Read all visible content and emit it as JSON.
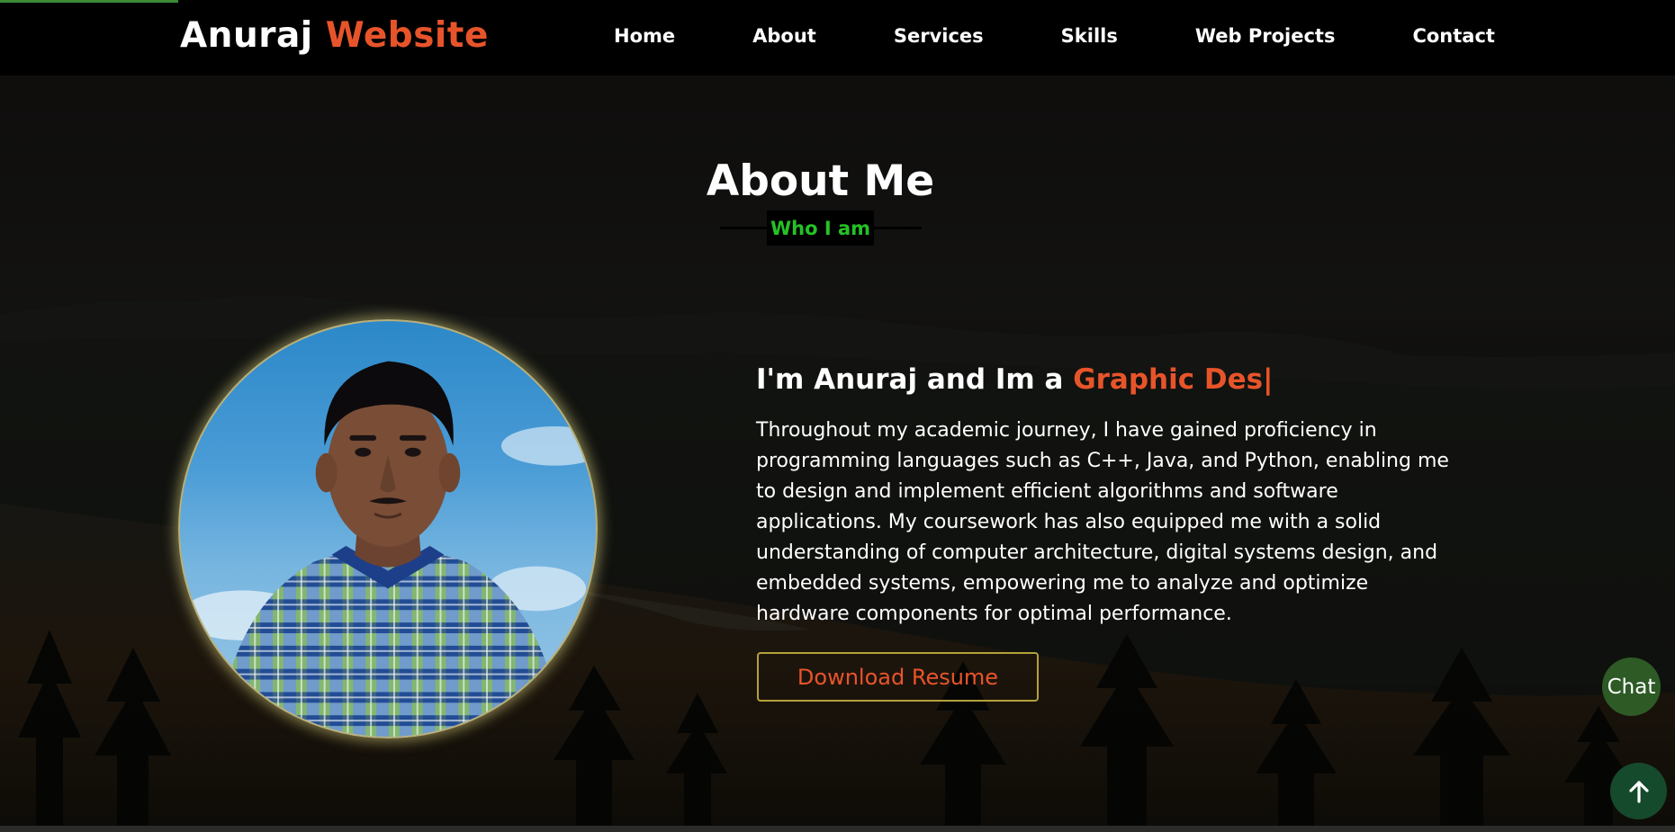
{
  "header": {
    "logo_primary": "Anuraj",
    "logo_accent": "Website",
    "nav": [
      "Home",
      "About",
      "Services",
      "Skills",
      "Web Projects",
      "Contact"
    ]
  },
  "about": {
    "title": "About Me",
    "subtitle": "Who I am",
    "intro_prefix": "I'm Anuraj and Im a ",
    "intro_typed": "Graphic Des",
    "intro_caret": "|",
    "paragraph": "Throughout my academic journey, I have gained proficiency in programming languages such as C++, Java, and Python, enabling me to design and implement efficient algorithms and software applications. My coursework has also equipped me with a solid understanding of computer architecture, digital systems design, and embedded systems, empowering me to analyze and optimize hardware components for optimal performance.",
    "download_label": "Download Resume"
  },
  "widgets": {
    "chat_label": "Chat",
    "scroll_top_icon": "arrow-up-icon"
  },
  "colors": {
    "accent": "#e8542a",
    "subtitle_green": "#25c226",
    "nav_bg": "#000000",
    "chat_bg": "#2d5a25",
    "scroll_top_bg": "#164a2c"
  }
}
